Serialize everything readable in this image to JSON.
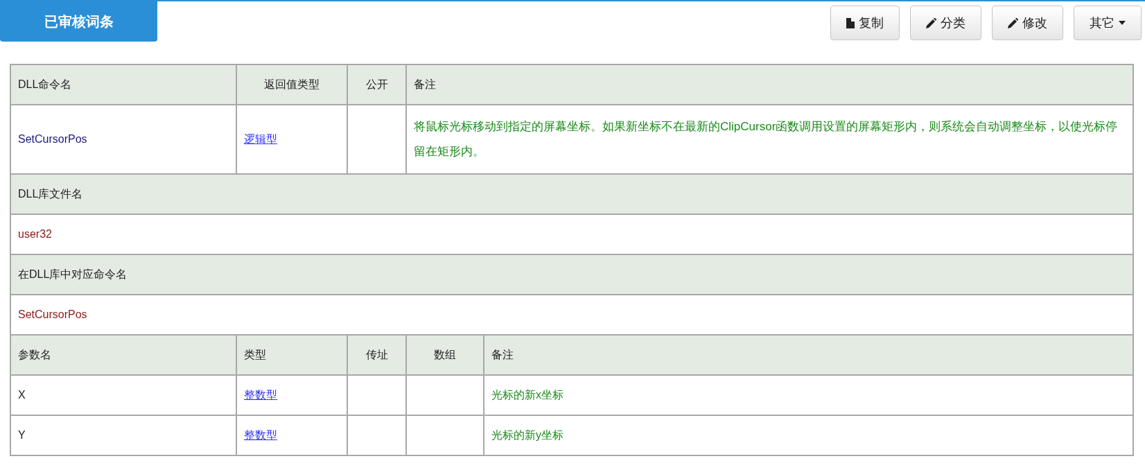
{
  "header_tab": {
    "label": "已审核词条"
  },
  "toolbar": [
    {
      "label": "复制",
      "kind": "copy"
    },
    {
      "label": "分类",
      "kind": "edit"
    },
    {
      "label": "修改",
      "kind": "edit"
    },
    {
      "label": "其它",
      "kind": "dropdown"
    }
  ],
  "command_table": {
    "columns": [
      "DLL命令名",
      "返回值类型",
      "公开",
      "备注"
    ],
    "row": {
      "name": "SetCursorPos",
      "return_type": "逻辑型",
      "note": "将鼠标光标移动到指定的屏幕坐标。如果新坐标不在最新的ClipCursor函数调用设置的屏幕矩形内，则系统会自动调整坐标，以使光标停留在矩形内。"
    }
  },
  "dll_file": {
    "label": "DLL库文件名",
    "value": "user32"
  },
  "dll_command": {
    "label": "在DLL库中对应命令名",
    "value": "SetCursorPos"
  },
  "params_table": {
    "columns": [
      "参数名",
      "类型",
      "传址",
      "数组",
      "备注"
    ],
    "rows": [
      {
        "name": "X",
        "type": "整数型",
        "note": "光标的新x坐标"
      },
      {
        "name": "Y",
        "type": "整数型",
        "note": "光标的新y坐标"
      }
    ]
  }
}
